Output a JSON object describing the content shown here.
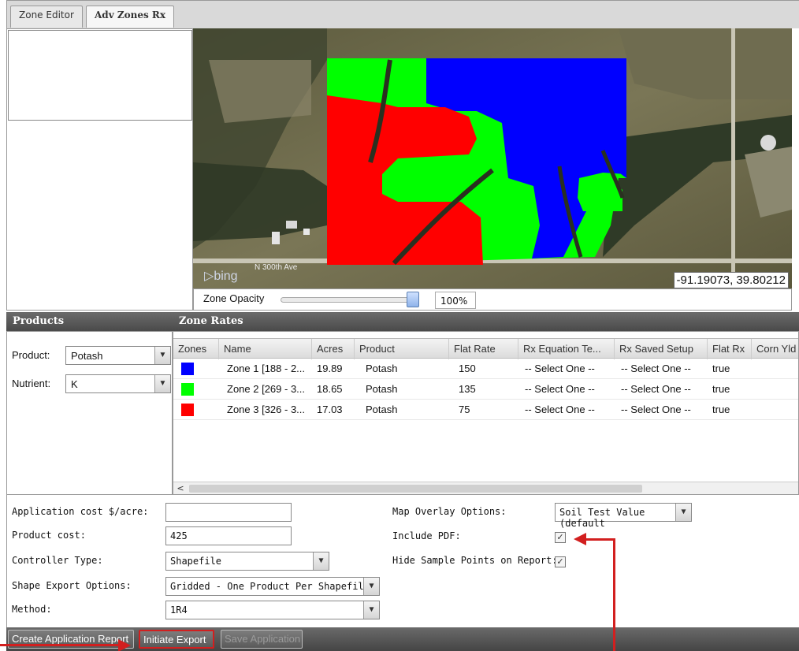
{
  "tabs": [
    {
      "label": "Zone Editor",
      "active": false
    },
    {
      "label": "Adv Zones Rx",
      "active": true
    }
  ],
  "map": {
    "coordinates": "-91.19073, 39.80212",
    "road_label": "N 300th Ave",
    "attribution": "bing",
    "opacity_label": "Zone Opacity",
    "opacity_value": "100%",
    "opacity_fraction": 1.0,
    "zone_colors": {
      "zone1": "#0000ff",
      "zone2": "#00ff00",
      "zone3": "#ff0000"
    }
  },
  "products": {
    "header": "Products",
    "product_label": "Product:",
    "product_value": "Potash",
    "nutrient_label": "Nutrient:",
    "nutrient_value": "K"
  },
  "zone_rates": {
    "header": "Zone Rates",
    "columns": [
      "Zones",
      "Name",
      "Acres",
      "Product",
      "Flat Rate",
      "Rx Equation Te...",
      "Rx Saved Setup",
      "Flat Rx",
      "Corn Yld"
    ],
    "rows": [
      {
        "color": "#0000ff",
        "name": "Zone 1 [188 - 2...",
        "acres": "19.89",
        "product": "Potash",
        "flat_rate": "150",
        "equation": "-- Select One --",
        "saved_setup": "-- Select One --",
        "flat_rx": "true"
      },
      {
        "color": "#00ff00",
        "name": "Zone 2 [269 - 3...",
        "acres": "18.65",
        "product": "Potash",
        "flat_rate": "135",
        "equation": "-- Select One --",
        "saved_setup": "-- Select One --",
        "flat_rx": "true"
      },
      {
        "color": "#ff0000",
        "name": "Zone 3 [326 - 3...",
        "acres": "17.03",
        "product": "Potash",
        "flat_rate": "75",
        "equation": "-- Select One --",
        "saved_setup": "-- Select One --",
        "flat_rx": "true"
      }
    ]
  },
  "form": {
    "app_cost_label": "Application cost $/acre:",
    "app_cost_value": "",
    "product_cost_label": "Product cost:",
    "product_cost_value": "425",
    "controller_label": "Controller Type:",
    "controller_value": "Shapefile",
    "shape_export_label": "Shape Export Options:",
    "shape_export_value": "Gridded - One Product Per Shapefile",
    "method_label": "Method:",
    "method_value": "1R4",
    "overlay_label": "Map Overlay Options:",
    "overlay_value": "Soil Test Value (default",
    "include_pdf_label": "Include PDF:",
    "include_pdf_checked": true,
    "hide_points_label": "Hide Sample Points on Report:",
    "hide_points_checked": true
  },
  "footer": {
    "create_report": "Create Application Report",
    "initiate_export": "Initiate Export",
    "save_application": "Save Application"
  },
  "glyphs": {
    "check": "✓",
    "dropdown": "▼",
    "left": "<"
  }
}
